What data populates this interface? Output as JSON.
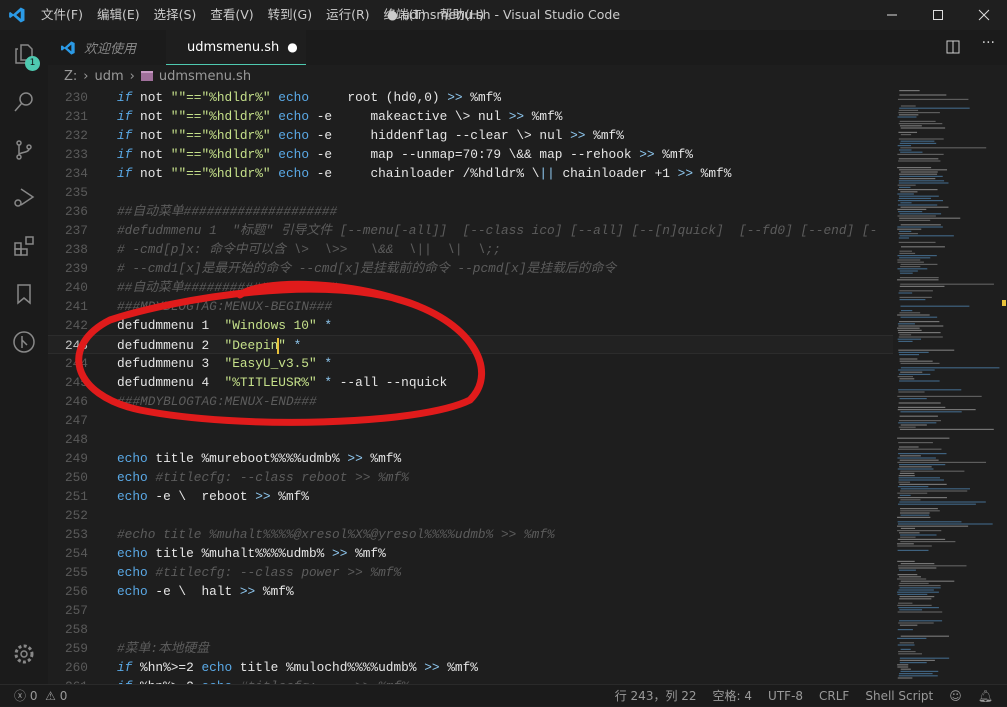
{
  "menu": [
    "文件(F)",
    "编辑(E)",
    "选择(S)",
    "查看(V)",
    "转到(G)",
    "运行(R)",
    "终端(T)",
    "帮助(H)"
  ],
  "window_title": "● udmsmenu.sh - Visual Studio Code",
  "activity_badge": "1",
  "tabs": [
    {
      "label": "欢迎使用",
      "active": false
    },
    {
      "label": "udmsmenu.sh",
      "active": true,
      "dirty": "●"
    }
  ],
  "breadcrumb": [
    "Z:",
    "udm",
    "udmsmenu.sh"
  ],
  "current_line": 243,
  "lines": [
    {
      "n": "230",
      "t": [
        [
          "k",
          "if"
        ],
        [
          "p",
          " not "
        ],
        [
          "s",
          "\"\"==\"%hdldr%\""
        ],
        [
          "p",
          " "
        ],
        [
          "e",
          "echo"
        ],
        [
          "p",
          "     root (hd0,0) "
        ],
        [
          "o",
          ">>"
        ],
        [
          "p",
          " %mf%"
        ]
      ]
    },
    {
      "n": "231",
      "t": [
        [
          "k",
          "if"
        ],
        [
          "p",
          " not "
        ],
        [
          "s",
          "\"\"==\"%hdldr%\""
        ],
        [
          "p",
          " "
        ],
        [
          "e",
          "echo"
        ],
        [
          "p",
          " -e     makeactive \\> nul "
        ],
        [
          "o",
          ">>"
        ],
        [
          "p",
          " %mf%"
        ]
      ]
    },
    {
      "n": "232",
      "t": [
        [
          "k",
          "if"
        ],
        [
          "p",
          " not "
        ],
        [
          "s",
          "\"\"==\"%hdldr%\""
        ],
        [
          "p",
          " "
        ],
        [
          "e",
          "echo"
        ],
        [
          "p",
          " -e     hiddenflag --clear \\> nul "
        ],
        [
          "o",
          ">>"
        ],
        [
          "p",
          " %mf%"
        ]
      ]
    },
    {
      "n": "233",
      "t": [
        [
          "k",
          "if"
        ],
        [
          "p",
          " not "
        ],
        [
          "s",
          "\"\"==\"%hdldr%\""
        ],
        [
          "p",
          " "
        ],
        [
          "e",
          "echo"
        ],
        [
          "p",
          " -e     map --unmap=70:79 \\&& map --rehook "
        ],
        [
          "o",
          ">>"
        ],
        [
          "p",
          " %mf%"
        ]
      ]
    },
    {
      "n": "234",
      "t": [
        [
          "k",
          "if"
        ],
        [
          "p",
          " not "
        ],
        [
          "s",
          "\"\"==\"%hdldr%\""
        ],
        [
          "p",
          " "
        ],
        [
          "e",
          "echo"
        ],
        [
          "p",
          " -e     chainloader /%hdldr% \\"
        ],
        [
          "o",
          "||"
        ],
        [
          "p",
          " chainloader +1 "
        ],
        [
          "o",
          ">>"
        ],
        [
          "p",
          " %mf%"
        ]
      ]
    },
    {
      "n": "235",
      "t": []
    },
    {
      "n": "236",
      "t": [
        [
          "c",
          "##自动菜单####################"
        ]
      ]
    },
    {
      "n": "237",
      "t": [
        [
          "c",
          "#defudmmenu 1  \"标题\" 引导文件 [--menu[-all]]  [--class ico] [--all] [--[n]quick]  [--fd0] [--end] [-"
        ]
      ]
    },
    {
      "n": "238",
      "t": [
        [
          "c",
          "# -cmd[p]x: 命令中可以含 \\>  \\>>   \\&&  \\||  \\|  \\;;"
        ]
      ]
    },
    {
      "n": "239",
      "t": [
        [
          "c",
          "# --cmd1[x]是最开始的命令 --cmd[x]是挂载前的命令 --pcmd[x]是挂载后的命令"
        ]
      ]
    },
    {
      "n": "240",
      "t": [
        [
          "c",
          "##自动菜单####################"
        ]
      ]
    },
    {
      "n": "241",
      "t": [
        [
          "c",
          "###MDYBLOGTAG:MENUX-BEGIN###"
        ]
      ]
    },
    {
      "n": "242",
      "t": [
        [
          "p",
          "defudmmenu 1  "
        ],
        [
          "s",
          "\"Windows 10\""
        ],
        [
          "p",
          " "
        ],
        [
          "o",
          "*"
        ]
      ]
    },
    {
      "n": "243",
      "t": [
        [
          "p",
          "defudmmenu 2  "
        ],
        [
          "s",
          "\"Deepin"
        ],
        [
          "cursor",
          ""
        ],
        [
          "s",
          "\""
        ],
        [
          "p",
          " "
        ],
        [
          "o",
          "*"
        ]
      ]
    },
    {
      "n": "244",
      "t": [
        [
          "p",
          "defudmmenu 3  "
        ],
        [
          "s",
          "\"EasyU_v3.5\""
        ],
        [
          "p",
          " "
        ],
        [
          "o",
          "*"
        ]
      ]
    },
    {
      "n": "245",
      "t": [
        [
          "p",
          "defudmmenu 4  "
        ],
        [
          "s",
          "\"%TITLEUSR%\""
        ],
        [
          "p",
          " "
        ],
        [
          "o",
          "*"
        ],
        [
          "p",
          " --all --nquick"
        ]
      ]
    },
    {
      "n": "246",
      "t": [
        [
          "c",
          "###MDYBLOGTAG:MENUX-END###"
        ]
      ]
    },
    {
      "n": "247",
      "t": []
    },
    {
      "n": "248",
      "t": []
    },
    {
      "n": "249",
      "t": [
        [
          "e",
          "echo"
        ],
        [
          "p",
          " title %mureboot%%%%udmb% "
        ],
        [
          "o",
          ">>"
        ],
        [
          "p",
          " %mf%"
        ]
      ]
    },
    {
      "n": "250",
      "t": [
        [
          "e",
          "echo"
        ],
        [
          "p",
          " "
        ],
        [
          "c",
          "#titlecfg: --class reboot >> %mf%"
        ]
      ]
    },
    {
      "n": "251",
      "t": [
        [
          "e",
          "echo"
        ],
        [
          "p",
          " -e \\  reboot "
        ],
        [
          "o",
          ">>"
        ],
        [
          "p",
          " %mf%"
        ]
      ]
    },
    {
      "n": "252",
      "t": []
    },
    {
      "n": "253",
      "t": [
        [
          "c",
          "#echo title %muhalt%%%%@xresol%X%@yresol%%%%udmb% >> %mf%"
        ]
      ]
    },
    {
      "n": "254",
      "t": [
        [
          "e",
          "echo"
        ],
        [
          "p",
          " title %muhalt%%%%udmb% "
        ],
        [
          "o",
          ">>"
        ],
        [
          "p",
          " %mf%"
        ]
      ]
    },
    {
      "n": "255",
      "t": [
        [
          "e",
          "echo"
        ],
        [
          "p",
          " "
        ],
        [
          "c",
          "#titlecfg: --class power >> %mf%"
        ]
      ]
    },
    {
      "n": "256",
      "t": [
        [
          "e",
          "echo"
        ],
        [
          "p",
          " -e \\  halt "
        ],
        [
          "o",
          ">>"
        ],
        [
          "p",
          " %mf%"
        ]
      ]
    },
    {
      "n": "257",
      "t": []
    },
    {
      "n": "258",
      "t": []
    },
    {
      "n": "259",
      "t": [
        [
          "c",
          "#菜单:本地硬盘"
        ]
      ]
    },
    {
      "n": "260",
      "t": [
        [
          "k",
          "if"
        ],
        [
          "p",
          " %hn%>=2 "
        ],
        [
          "e",
          "echo"
        ],
        [
          "p",
          " title %mulochd%%%%udmb% "
        ],
        [
          "o",
          ">>"
        ],
        [
          "p",
          " %mf%"
        ]
      ]
    },
    {
      "n": "261",
      "t": [
        [
          "k",
          "if"
        ],
        [
          "p",
          " %hn%>=2 "
        ],
        [
          "e",
          "echo"
        ],
        [
          "p",
          " "
        ],
        [
          "c",
          "#titlecfg: ... >> %mf%"
        ]
      ]
    }
  ],
  "status": {
    "errors": "0",
    "warnings": "0",
    "position": "行 243，列 22",
    "indent": "空格: 4",
    "encoding": "UTF-8",
    "eol": "CRLF",
    "language": "Shell Script"
  }
}
